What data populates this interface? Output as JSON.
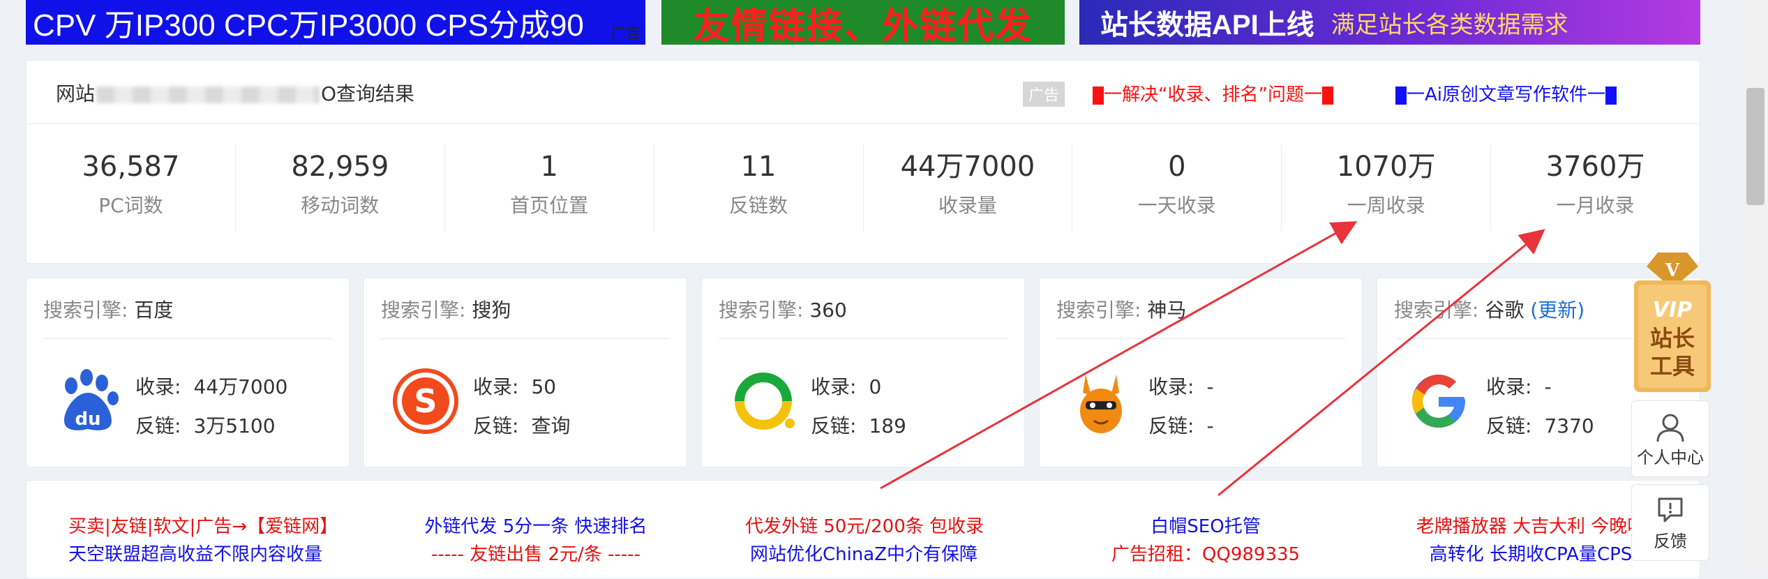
{
  "banners": {
    "b1_text": "CPV 万IP300 CPC万IP3000 CPS分成90",
    "b1_tag": "广告",
    "b2_text": "友情链接、外链代发",
    "b3_text": "站长数据API上线",
    "b3_sub": "满足站长各类数据需求"
  },
  "summary": {
    "title_prefix": "网站",
    "title_suffix": "O查询结果",
    "ad_tag": "广告",
    "ad_link1": "一解决“收录、排名”问题一",
    "ad_link2": "一Ai原创文章写作软件一",
    "stats": [
      {
        "value": "36,587",
        "label": "PC词数"
      },
      {
        "value": "82,959",
        "label": "移动词数"
      },
      {
        "value": "1",
        "label": "首页位置"
      },
      {
        "value": "11",
        "label": "反链数"
      },
      {
        "value": "44万7000",
        "label": "收录量"
      },
      {
        "value": "0",
        "label": "一天收录"
      },
      {
        "value": "1070万",
        "label": "一周收录"
      },
      {
        "value": "3760万",
        "label": "一月收录"
      }
    ]
  },
  "engines": [
    {
      "label": "搜索引擎:",
      "name": "百度",
      "k1": "收录:",
      "v1": "44万7000",
      "k2": "反链:",
      "v2": "3万5100"
    },
    {
      "label": "搜索引擎:",
      "name": "搜狗",
      "k1": "收录:",
      "v1": "50",
      "k2": "反链:",
      "v2": "查询"
    },
    {
      "label": "搜索引擎:",
      "name": "360",
      "k1": "收录:",
      "v1": "0",
      "k2": "反链:",
      "v2": "189"
    },
    {
      "label": "搜索引擎:",
      "name": "神马",
      "k1": "收录:",
      "v1": "-",
      "k2": "反链:",
      "v2": "-"
    },
    {
      "label": "搜索引擎:",
      "name": "谷歌",
      "update": "(更新)",
      "k1": "收录:",
      "v1": "-",
      "k2": "反链:",
      "v2": "7370"
    }
  ],
  "ads": [
    {
      "l1": "买卖|友链|软文|广告→【爱链网】",
      "l2": "天空联盟超高收益不限内容收量",
      "c1": "#e81010",
      "c2": "#1010e8"
    },
    {
      "l1": "外链代发 5分一条 快速排名",
      "l2": "----- 友链出售 2元/条 -----",
      "c1": "#1010e8",
      "c2": "#e81010"
    },
    {
      "l1": "代发外链 50元/200条 包收录",
      "l2": "网站优化ChinaZ中介有保障",
      "c1": "#e81010",
      "c2": "#1010e8"
    },
    {
      "l1": "白帽SEO托管",
      "l2": "广告招租：QQ989335",
      "c1": "#1010e8",
      "c2": "#e81010"
    },
    {
      "l1": "老牌播放器 大吉大利 今晚吃",
      "l2": "高转化 长期收CPA量CPS",
      "c1": "#e81010",
      "c2": "#1010e8"
    }
  ],
  "side": {
    "vip_l1": "VIP",
    "vip_l2": "站长",
    "vip_l3": "工具",
    "vip_badge": "V",
    "personal": "个人中心",
    "feedback": "反馈"
  },
  "colors": {
    "accent_red": "#ff1010",
    "accent_blue": "#1010ff",
    "link_blue": "#1e6fd6",
    "arrow": "#e8333a"
  }
}
